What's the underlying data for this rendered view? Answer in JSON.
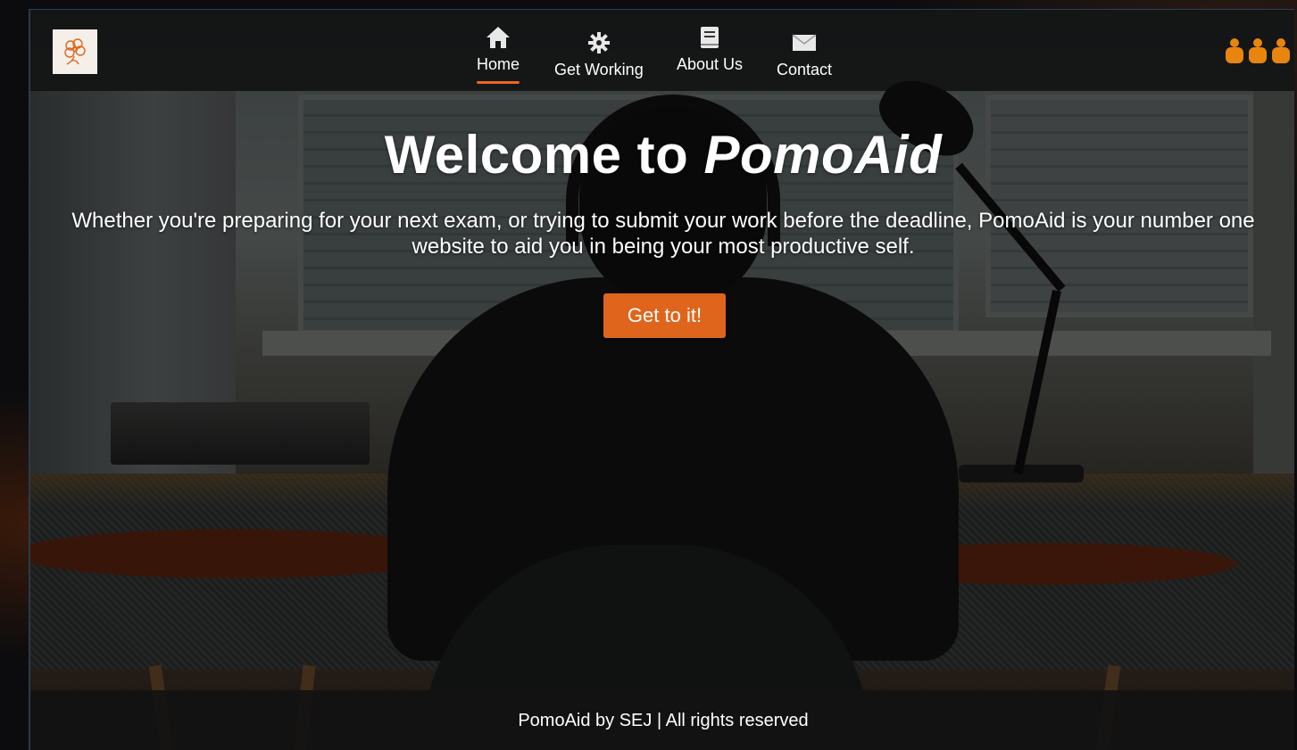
{
  "brand": {
    "logo_icon": "flower-doodle-logo",
    "accent_color": "#e0651c"
  },
  "nav": {
    "items": [
      {
        "label": "Home",
        "icon": "home-icon",
        "active": true
      },
      {
        "label": "Get Working",
        "icon": "gear-icon",
        "active": false
      },
      {
        "label": "About Us",
        "icon": "book-icon",
        "active": false
      },
      {
        "label": "Contact",
        "icon": "envelope-icon",
        "active": false
      }
    ],
    "user_icons": [
      "user-icon",
      "user-icon",
      "user-icon"
    ]
  },
  "hero": {
    "title_prefix": "Welcome to ",
    "title_brand": "PomoAid",
    "description": "Whether you're preparing for your next exam, or trying to submit your work before the deadline, PomoAid is your number one website to aid you in being your most productive self.",
    "cta_label": "Get to it!"
  },
  "footer": {
    "text": "PomoAid by SEJ | All rights reserved"
  }
}
